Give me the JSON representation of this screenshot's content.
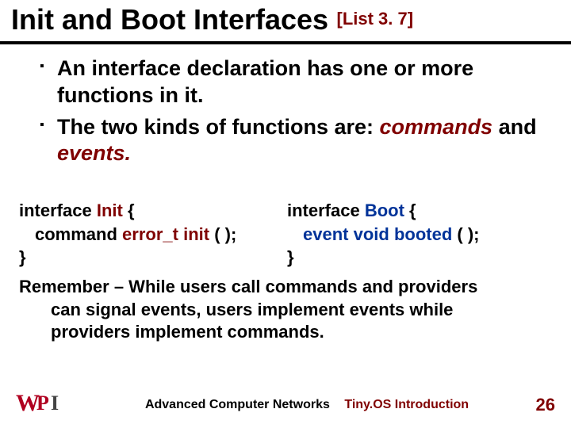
{
  "title": {
    "main": "Init and Boot Interfaces",
    "tag": "[List 3. 7]"
  },
  "bullets": {
    "b1": "An interface declaration has one or more functions in it.",
    "b2_lead": "The two kinds of functions are: ",
    "b2_em1": "commands",
    "b2_and": " and ",
    "b2_em2": "events."
  },
  "code": {
    "left": {
      "l1a": "interface ",
      "l1b": "Init ",
      "l1c": "{",
      "l2a": "command ",
      "l2b": "error_t ",
      "l2c": "init ",
      "l2d": "( );",
      "l3": "}"
    },
    "right": {
      "l1a": "interface ",
      "l1b": "Boot ",
      "l1c": "{",
      "l2a": "event ",
      "l2b": "void ",
      "l2c": "booted ",
      "l2d": "( );",
      "l3": "}"
    }
  },
  "remember": {
    "line1": "Remember – While users call commands and providers",
    "line2": "can signal events, users implement events while",
    "line3": "providers implement commands."
  },
  "footer": {
    "course": "Advanced Computer Networks",
    "topic": "Tiny.OS Introduction",
    "page": "26",
    "logo": {
      "w": "W",
      "p": "P",
      "i": "I"
    }
  }
}
